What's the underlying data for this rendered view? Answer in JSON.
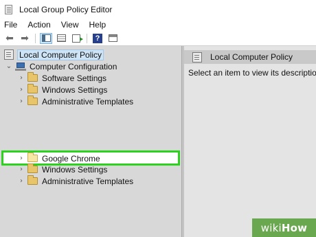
{
  "window": {
    "title": "Local Group Policy Editor",
    "app_icon": "policy-icon"
  },
  "menubar": {
    "items": [
      "File",
      "Action",
      "View",
      "Help"
    ]
  },
  "toolbar": {
    "buttons": [
      "back-arrow-icon",
      "forward-arrow-icon",
      "show-hide-tree-icon",
      "console-tree-icon",
      "export-list-icon",
      "help-icon",
      "properties-icon"
    ],
    "help_glyph": "?"
  },
  "tree": {
    "root": "Local Computer Policy",
    "computer_config": "Computer Configuration",
    "items": [
      {
        "label": "Software Settings"
      },
      {
        "label": "Windows Settings"
      },
      {
        "label": "Administrative Templates"
      },
      {
        "label": "Google Chrome",
        "highlighted": true
      },
      {
        "label": "Windows Settings"
      },
      {
        "label": "Administrative Templates"
      }
    ],
    "highlight_color": "#2cd21d"
  },
  "details": {
    "header": "Local Computer Policy",
    "description": "Select an item to view its description"
  },
  "watermark": {
    "part1": "wiki",
    "part2": "How",
    "color": "#6aa84f"
  }
}
